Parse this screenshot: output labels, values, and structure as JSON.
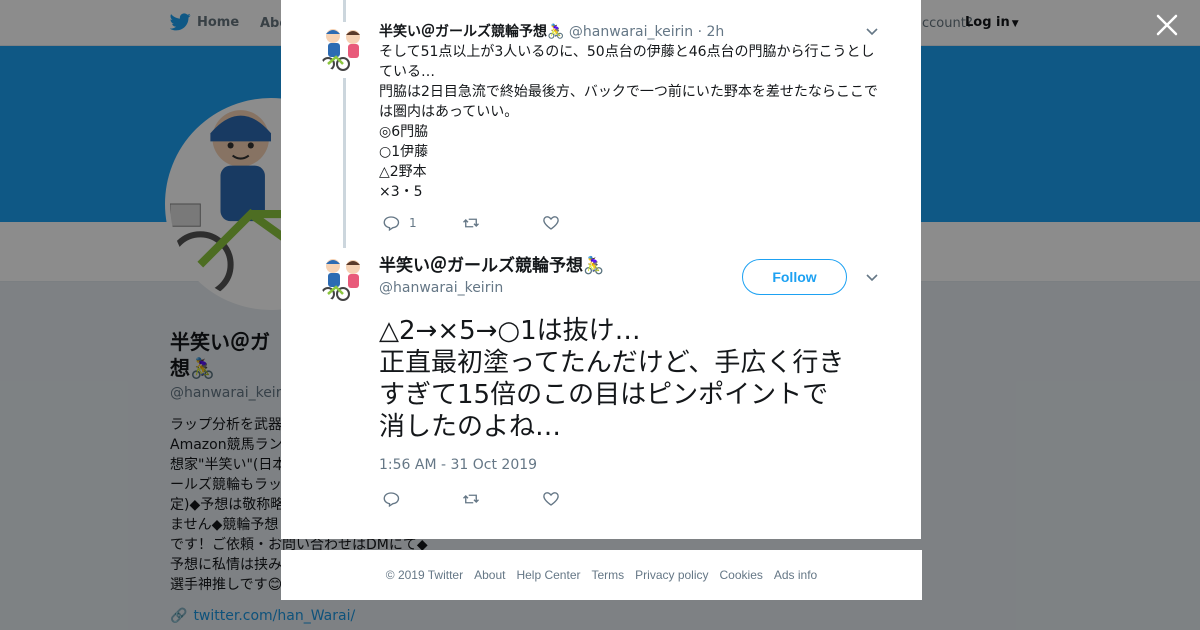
{
  "nav": {
    "home_label": "Home",
    "about_label": "Abo",
    "account_text": "ccount?",
    "login_label": "Log in"
  },
  "profile": {
    "name": "半笑い＠ガ\n想🚴‍♀️",
    "handle": "@hanwarai_keirin",
    "bio_lines": [
      "ラップ分析を武器",
      "Amazon競馬ランキ",
      "想家\"半笑い\"(日本",
      "ールズ競輪もラッ",
      "定)◆予想は敬称略",
      "ません◆競輪予想",
      "です！ご依頼・お問い合わせはDMにて◆",
      "予想に私情は挟み",
      "選手神推しです😊"
    ],
    "link": "twitter.com/han_Warai/"
  },
  "modal": {
    "close_icon": "close-icon",
    "tweet1": {
      "name": "半笑い＠ガールズ競輪予想🚴‍♀️",
      "handle": "@hanwarai_keirin",
      "time": "· 2h",
      "body_lines": [
        "そして51点以上が3人いるのに、50点台の伊藤と46点台の門脇から行こうとし",
        "ている…",
        "門脇は2日目急流で終始最後方、バックで一つ前にいた野本を差せたならここで",
        "は圏内はあっていい。",
        "◎6門脇",
        "○1伊藤",
        "△2野本",
        "×3・5"
      ],
      "reply_count": "1"
    },
    "tweet2": {
      "name": "半笑い＠ガールズ競輪予想🚴‍♀️",
      "handle": "@hanwarai_keirin",
      "follow_label": "Follow",
      "body_lines": [
        "△2→×5→○1は抜け…",
        "正直最初塗ってたんだけど、手広く行き",
        "すぎて15倍のこの目はピンポイントで",
        "消したのよね…"
      ],
      "timestamp": "1:56 AM - 31 Oct 2019"
    }
  },
  "footer": {
    "items": [
      "© 2019 Twitter",
      "About",
      "Help Center",
      "Terms",
      "Privacy policy",
      "Cookies",
      "Ads info"
    ]
  },
  "colors": {
    "brand": "#1da1f2",
    "text": "#14171a",
    "secondary": "#657786"
  }
}
